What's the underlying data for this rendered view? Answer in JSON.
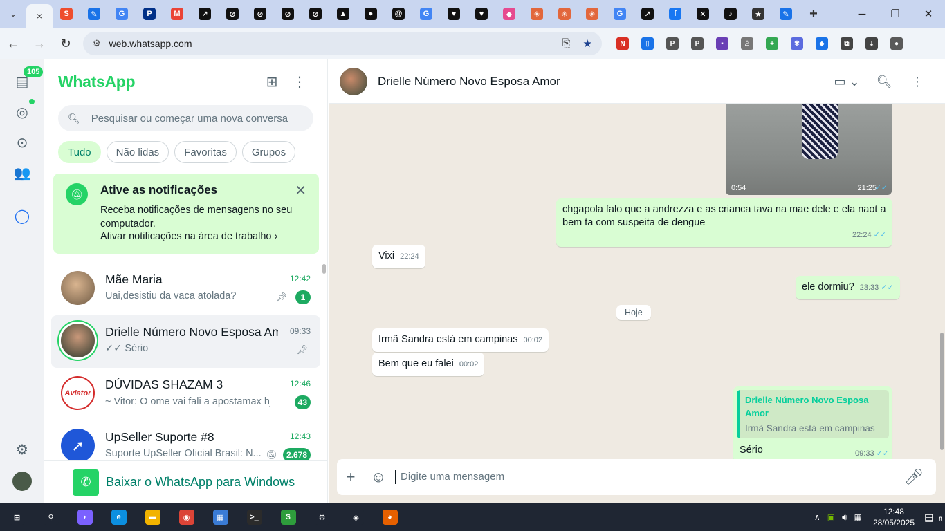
{
  "browser": {
    "url": "web.whatsapp.com",
    "tab_close": "×",
    "new_tab": "+",
    "tab_favicons": [
      {
        "icon": "shopee-icon",
        "color": "#ee4d2d",
        "glyph": "S"
      },
      {
        "icon": "pencil-app-icon",
        "color": "#1a73e8",
        "glyph": "✎"
      },
      {
        "icon": "google-translate-icon",
        "color": "#4285f4",
        "glyph": "G"
      },
      {
        "icon": "paypal-icon",
        "color": "#003087",
        "glyph": "P"
      },
      {
        "icon": "gmail-icon",
        "color": "#ea4335",
        "glyph": "M"
      },
      {
        "icon": "chart-app-icon",
        "color": "#111111",
        "glyph": "↗"
      },
      {
        "icon": "slash-icon",
        "color": "#111111",
        "glyph": "⊘"
      },
      {
        "icon": "slash-icon",
        "color": "#111111",
        "glyph": "⊘"
      },
      {
        "icon": "slash-icon",
        "color": "#111111",
        "glyph": "⊘"
      },
      {
        "icon": "slash-icon",
        "color": "#111111",
        "glyph": "⊘"
      },
      {
        "icon": "triangle-app-icon",
        "color": "#111111",
        "glyph": "▲"
      },
      {
        "icon": "github-icon",
        "color": "#111111",
        "glyph": "●"
      },
      {
        "icon": "threads-icon",
        "color": "#111111",
        "glyph": "@"
      },
      {
        "icon": "google-icon",
        "color": "#4285f4",
        "glyph": "G"
      },
      {
        "icon": "heart-app-icon",
        "color": "#111111",
        "glyph": "♥"
      },
      {
        "icon": "heart-app-icon",
        "color": "#111111",
        "glyph": "♥"
      },
      {
        "icon": "colorful-app-icon",
        "color": "#e64a8f",
        "glyph": "◆"
      },
      {
        "icon": "asterisk-app-icon",
        "color": "#e2673c",
        "glyph": "✳"
      },
      {
        "icon": "asterisk-app-icon",
        "color": "#e2673c",
        "glyph": "✳"
      },
      {
        "icon": "asterisk-app-icon",
        "color": "#e2673c",
        "glyph": "✳"
      },
      {
        "icon": "google-icon",
        "color": "#4285f4",
        "glyph": "G"
      },
      {
        "icon": "chart-app-icon",
        "color": "#111111",
        "glyph": "↗"
      },
      {
        "icon": "facebook-icon",
        "color": "#1877f2",
        "glyph": "f"
      },
      {
        "icon": "x-app-icon",
        "color": "#111111",
        "glyph": "✕"
      },
      {
        "icon": "tiktok-icon",
        "color": "#111111",
        "glyph": "♪"
      },
      {
        "icon": "star-app-icon",
        "color": "#333333",
        "glyph": "★"
      },
      {
        "icon": "pencil-app-icon",
        "color": "#1a73e8",
        "glyph": "✎"
      }
    ],
    "extensions": [
      {
        "icon": "new-badge-extension-icon",
        "color": "#d93025",
        "glyph": "N"
      },
      {
        "icon": "document-extension-icon",
        "color": "#1a73e8",
        "glyph": "▯"
      },
      {
        "icon": "p-extension-icon",
        "color": "#555555",
        "glyph": "P"
      },
      {
        "icon": "p-extension-icon",
        "color": "#555555",
        "glyph": "P"
      },
      {
        "icon": "purple-extension-icon",
        "color": "#6a3fb5",
        "glyph": "▪"
      },
      {
        "icon": "figure-extension-icon",
        "color": "#777777",
        "glyph": "♙"
      },
      {
        "icon": "plus-extension-icon",
        "color": "#34a853",
        "glyph": "+"
      },
      {
        "icon": "gear-extension-icon",
        "color": "#5b6bdf",
        "glyph": "✱"
      },
      {
        "icon": "blue-extension-icon",
        "color": "#1a73e8",
        "glyph": "◆"
      },
      {
        "icon": "puzzle-icon",
        "color": "#444444",
        "glyph": "⧉"
      },
      {
        "icon": "download-icon",
        "color": "#444444",
        "glyph": "⤓"
      },
      {
        "icon": "profile-avatar-icon",
        "color": "#5a5a5a",
        "glyph": "●"
      }
    ]
  },
  "rail": {
    "unread_badge": "105"
  },
  "sidebar": {
    "title": "WhatsApp",
    "search_placeholder": "Pesquisar ou começar uma nova conversa",
    "filters": [
      {
        "label": "Tudo",
        "active": true
      },
      {
        "label": "Não lidas",
        "active": false
      },
      {
        "label": "Favoritas",
        "active": false
      },
      {
        "label": "Grupos",
        "active": false
      }
    ],
    "notification_banner": {
      "title": "Ative as notificações",
      "body": "Receba notificações de mensagens no seu computador.",
      "link": "Ativar notificações na área de trabalho ›"
    },
    "chats": [
      {
        "name": "Mãe Maria",
        "time": "12:42",
        "preview": "Uai,desistiu da vaca atolada?",
        "unread": "1",
        "pinned": true,
        "avatar_color": "#9c7a5e",
        "avatar_glyph": ""
      },
      {
        "name": "Drielle Número Novo Esposa Amor",
        "time": "09:33",
        "preview": "✓✓ Sério",
        "unread": "",
        "pinned": true,
        "selected": true,
        "avatar_color": "#3b4a3c",
        "avatar_glyph": ""
      },
      {
        "name": "DÚVIDAS SHAZAM 3",
        "time": "12:46",
        "preview": "~ Vitor: O ome vai fali a apostamax hj 🤣",
        "unread": "43",
        "pinned": false,
        "avatar_color": "#d42a2a",
        "avatar_glyph": "Aviator"
      },
      {
        "name": "UpSeller Suporte #8",
        "time": "12:43",
        "preview": "Suporte UpSeller Oficial Brasil: N...",
        "unread": "2.678",
        "muted": true,
        "avatar_color": "#1f57d8",
        "avatar_glyph": "➚"
      }
    ],
    "footer": "Baixar o WhatsApp para Windows"
  },
  "conversation": {
    "contact_name": "Drielle Número Novo Esposa Amor",
    "video": {
      "duration": "0:54",
      "time": "21:25"
    },
    "messages": [
      {
        "dir": "out",
        "text": "chgapola falo que a andrezza e as crianca tava na mae dele e ela naot a bem ta com suspeita de dengue",
        "time": "22:24"
      },
      {
        "dir": "in",
        "text": "Vixi",
        "time": "22:24"
      },
      {
        "dir": "out",
        "text": "ele dormiu?",
        "time": "23:33"
      },
      {
        "dir": "in",
        "text": "Irmã Sandra está em campinas",
        "time": "00:02"
      },
      {
        "dir": "in",
        "text": "Bem que eu falei",
        "time": "00:02"
      },
      {
        "dir": "out",
        "quote_name": "Drielle Número Novo Esposa Amor",
        "quote_text": "Irmã Sandra está em campinas",
        "text": "Sério",
        "time": "09:33"
      }
    ],
    "date_separator": "Hoje",
    "composer_placeholder": "Digite uma mensagem"
  },
  "taskbar": {
    "apps": [
      {
        "icon": "windows-start-icon",
        "color": "#1f2633",
        "glyph": "⊞"
      },
      {
        "icon": "search-icon",
        "color": "#1f2633",
        "glyph": "⚲"
      },
      {
        "icon": "copilot-icon",
        "color": "#7b61ff",
        "glyph": "◗"
      },
      {
        "icon": "edge-icon",
        "color": "#0c8fe0",
        "glyph": "e"
      },
      {
        "icon": "file-explorer-icon",
        "color": "#f2b300",
        "glyph": "▬"
      },
      {
        "icon": "chrome-icon",
        "color": "#db4437",
        "glyph": "◉"
      },
      {
        "icon": "calculator-icon",
        "color": "#3a7bd5",
        "glyph": "▦"
      },
      {
        "icon": "terminal-icon",
        "color": "#2b2b2b",
        "glyph": ">_"
      },
      {
        "icon": "money-app-icon",
        "color": "#2e9d3c",
        "glyph": "$"
      },
      {
        "icon": "settings-icon",
        "color": "#1f2633",
        "glyph": "⚙"
      },
      {
        "icon": "cube-app-icon",
        "color": "#1f2633",
        "glyph": "◈"
      },
      {
        "icon": "firefox-icon",
        "color": "#e66000",
        "glyph": "◕"
      }
    ],
    "time": "12:48",
    "date": "28/05/2025",
    "notifications": "8"
  }
}
